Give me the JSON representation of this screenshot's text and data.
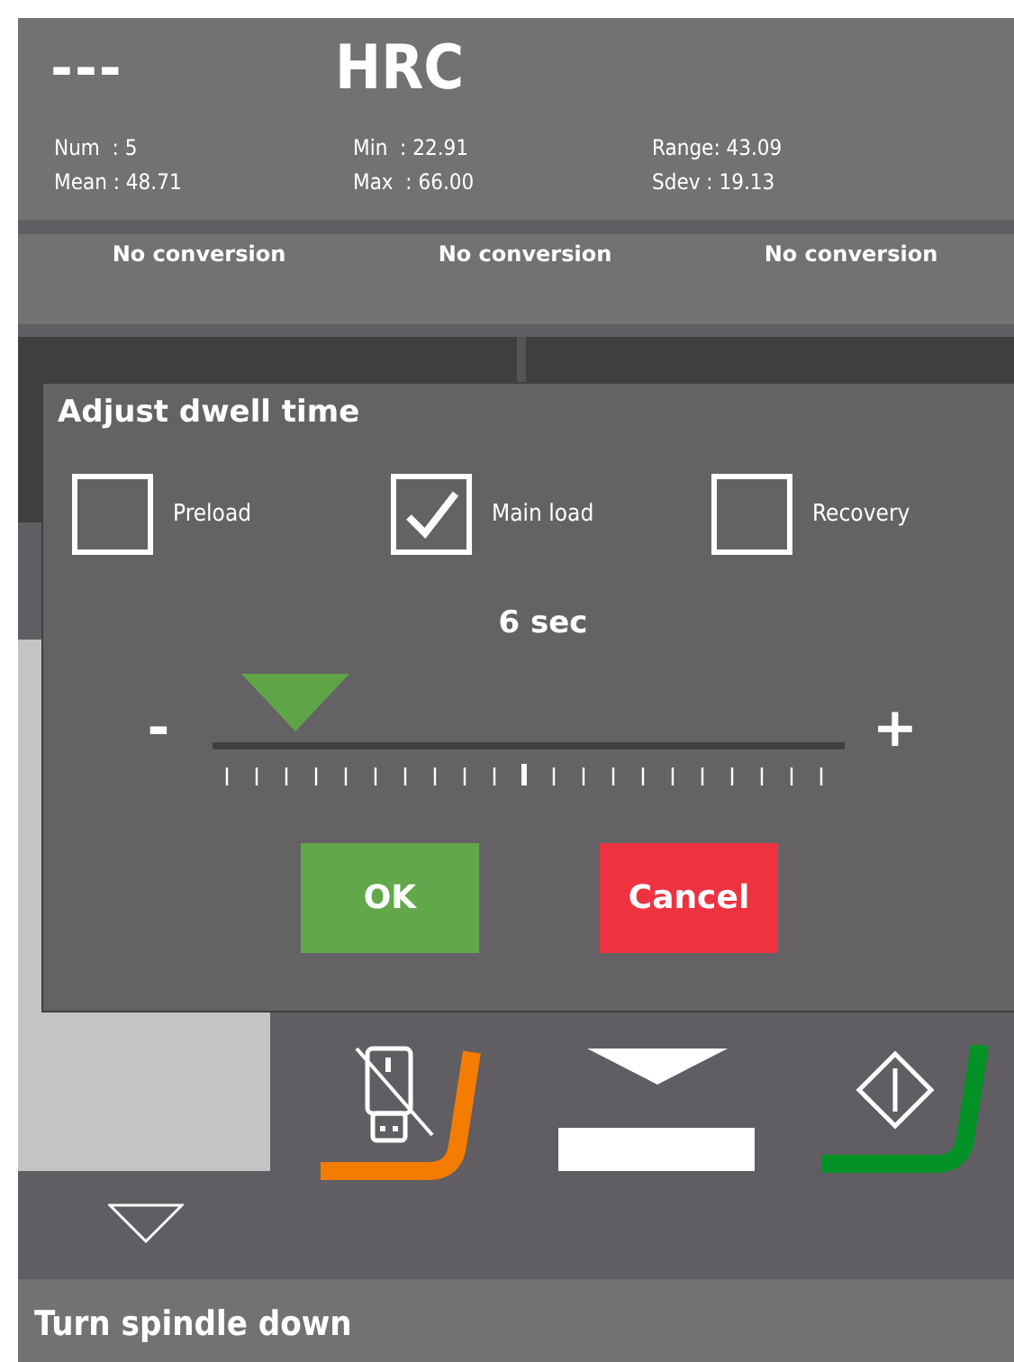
{
  "header": {
    "value": "---",
    "scale": "HRC",
    "stats": [
      {
        "text": "Num  : 5"
      },
      {
        "text": "Min  : 22.91"
      },
      {
        "text": "Range: 43.09"
      },
      {
        "text": "Mean : 48.71"
      },
      {
        "text": "Max  : 66.00"
      },
      {
        "text": "Sdev : 19.13"
      }
    ]
  },
  "conversions": [
    "No conversion",
    "No conversion",
    "No conversion"
  ],
  "dialog": {
    "title": "Adjust dwell time",
    "checkboxes": [
      {
        "label": "Preload",
        "checked": false
      },
      {
        "label": "Main load",
        "checked": true
      },
      {
        "label": "Recovery",
        "checked": false
      }
    ],
    "reading": "6 sec",
    "slider": {
      "minus": "-",
      "plus": "+",
      "level": 0.13
    },
    "buttons": [
      {
        "label": "OK",
        "kind": "ok"
      },
      {
        "label": "Cancel",
        "kind": "cancel"
      }
    ]
  },
  "status": "Turn spindle down"
}
